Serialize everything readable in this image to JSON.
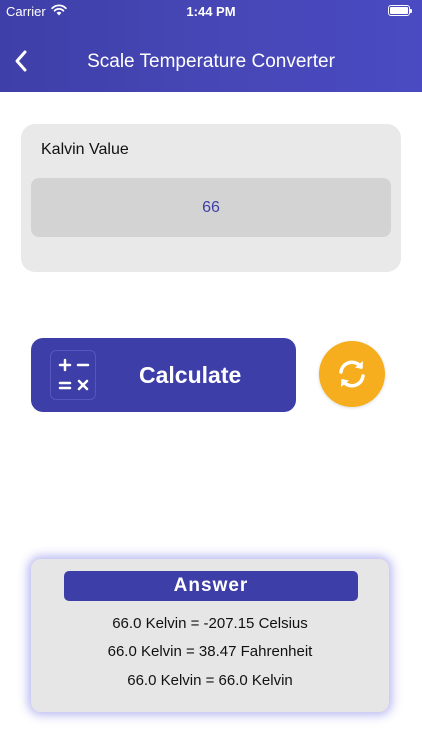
{
  "status_bar": {
    "carrier": "Carrier",
    "time": "1:44 PM"
  },
  "nav": {
    "title": "Scale Temperature Converter",
    "back_icon": "chevron-left-icon"
  },
  "input": {
    "label": "Kalvin Value",
    "value": "66"
  },
  "actions": {
    "calculate_label": "Calculate",
    "calculate_icon": "calculator-icon",
    "reset_icon": "refresh-icon"
  },
  "answer": {
    "title": "Answer",
    "results": [
      "66.0 Kelvin = -207.15 Celsius",
      "66.0 Kelvin = 38.47 Fahrenheit",
      "66.0 Kelvin = 66.0 Kelvin"
    ]
  },
  "colors": {
    "primary": "#3e3ea8",
    "accent": "#f6ae1e",
    "card_background": "#e9e9e9",
    "field_background": "#d3d3d3"
  }
}
